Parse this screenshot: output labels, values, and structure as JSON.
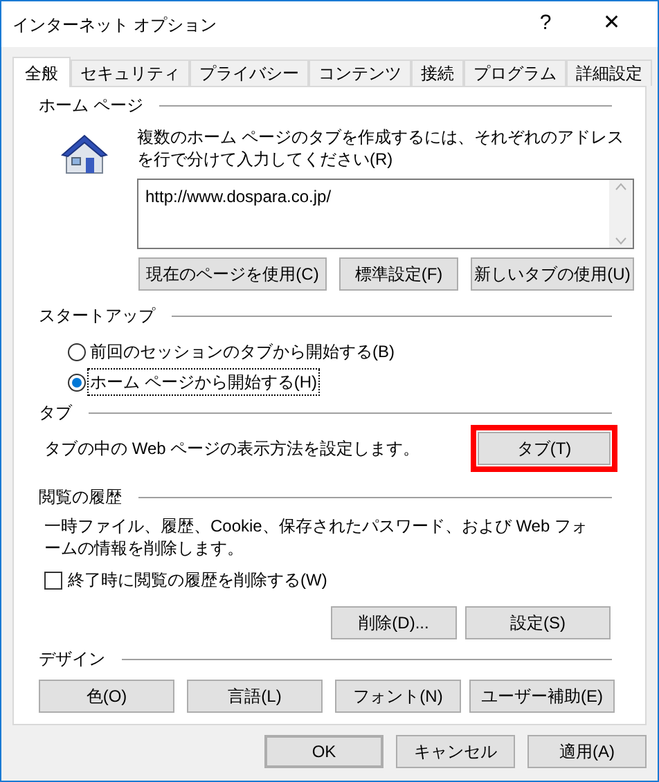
{
  "window": {
    "title": "インターネット オプション",
    "help": "?",
    "close": "✕"
  },
  "tabs": [
    {
      "label": "全般",
      "selected": true
    },
    {
      "label": "セキュリティ",
      "selected": false
    },
    {
      "label": "プライバシー",
      "selected": false
    },
    {
      "label": "コンテンツ",
      "selected": false
    },
    {
      "label": "接続",
      "selected": false
    },
    {
      "label": "プログラム",
      "selected": false
    },
    {
      "label": "詳細設定",
      "selected": false
    }
  ],
  "home_page": {
    "heading": "ホーム ページ",
    "description": "複数のホーム ページのタブを作成するには、それぞれのアドレスを行で分けて入力してください(R)",
    "value": "http://www.dospara.co.jp/",
    "buttons": [
      "現在のページを使用(C)",
      "標準設定(F)",
      "新しいタブの使用(U)"
    ]
  },
  "startup": {
    "heading": "スタートアップ",
    "options": [
      {
        "label": "前回のセッションのタブから開始する(B)",
        "selected": false,
        "focused": false
      },
      {
        "label": "ホーム ページから開始する(H)",
        "selected": true,
        "focused": true
      }
    ]
  },
  "tabs_section": {
    "heading": "タブ",
    "description": "タブの中の Web ページの表示方法を設定します。",
    "button": "タブ(T)",
    "highlighted": true
  },
  "history": {
    "heading": "閲覧の履歴",
    "description": "一時ファイル、履歴、Cookie、保存されたパスワード、および Web フォームの情報を削除します。",
    "checkbox": {
      "label": "終了時に閲覧の履歴を削除する(W)",
      "checked": false
    },
    "buttons": [
      "削除(D)...",
      "設定(S)"
    ]
  },
  "design": {
    "heading": "デザイン",
    "buttons": [
      "色(O)",
      "言語(L)",
      "フォント(N)",
      "ユーザー補助(E)"
    ]
  },
  "footer": [
    {
      "label": "OK",
      "default": true
    },
    {
      "label": "キャンセル",
      "default": false
    },
    {
      "label": "適用(A)",
      "default": false
    }
  ]
}
